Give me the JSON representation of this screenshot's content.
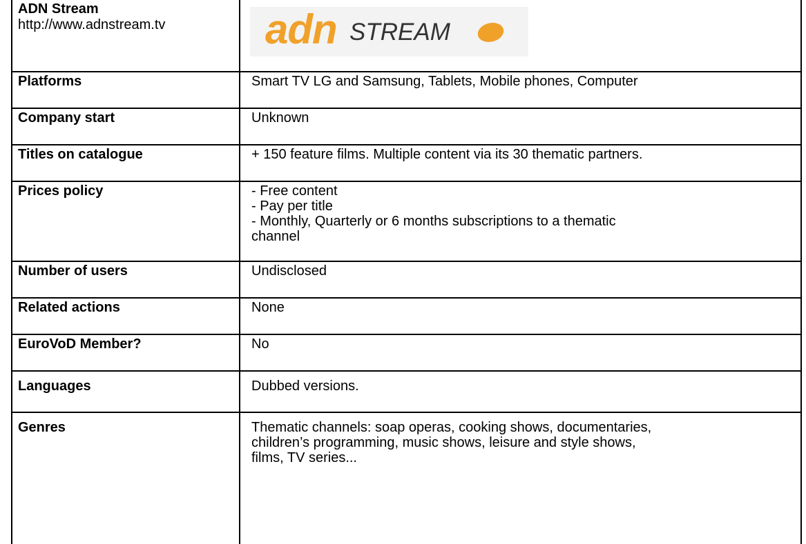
{
  "header": {
    "name": "ADN Stream",
    "url": "http://www.adnstream.tv",
    "logo": {
      "part1": "adn",
      "part2": "STREAM",
      "primary_color": "#f0a12a",
      "secondary_color": "#333333"
    }
  },
  "rows": [
    {
      "label": "Platforms",
      "lines": [
        "Smart TV LG and Samsung, Tablets, Mobile phones, Computer"
      ]
    },
    {
      "label": "Company start",
      "lines": [
        "Unknown"
      ]
    },
    {
      "label": "Titles on catalogue",
      "lines": [
        "+ 150 feature films. Multiple content via its 30 thematic partners."
      ]
    },
    {
      "label": "Prices policy",
      "lines": [
        "- Free content",
        "- Pay per title",
        "- Monthly, Quarterly or 6 months subscriptions to a thematic",
        "channel"
      ]
    },
    {
      "label": "Number of users",
      "lines": [
        "Undisclosed"
      ]
    },
    {
      "label": "Related actions",
      "lines": [
        "None"
      ]
    },
    {
      "label": "EuroVoD Member?",
      "lines": [
        "No"
      ]
    },
    {
      "label": "Languages",
      "lines": [
        "Dubbed versions."
      ]
    },
    {
      "label": "Genres",
      "lines": [
        "Thematic channels: soap operas, cooking shows, documentaries,",
        "children’s programming, music shows, leisure and style shows,",
        "films, TV series..."
      ]
    }
  ]
}
